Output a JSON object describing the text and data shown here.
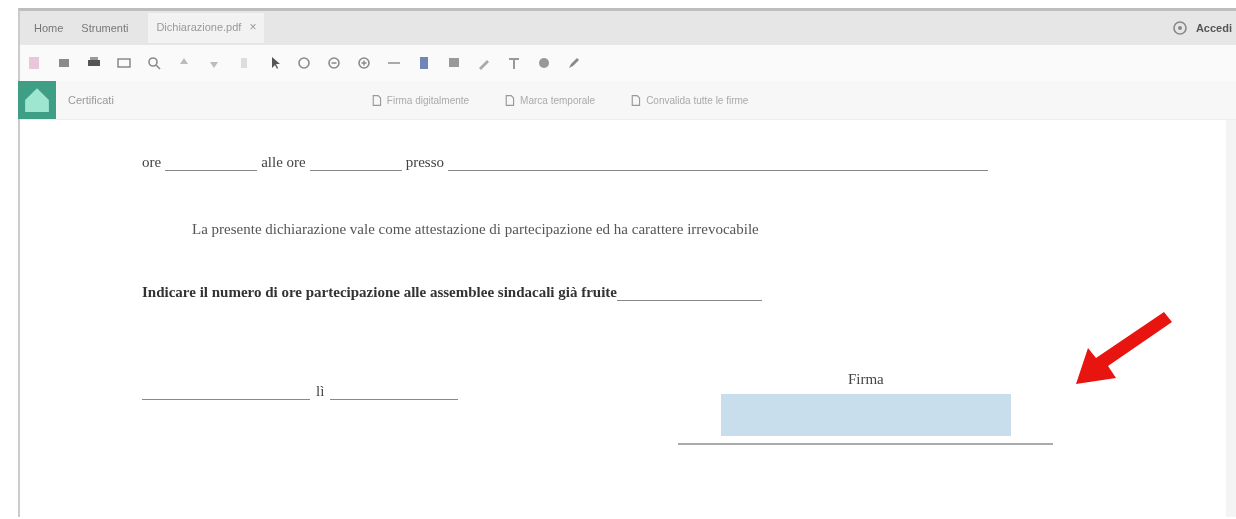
{
  "top_bar": {
    "nav": [
      {
        "label": "Home",
        "selected": false
      },
      {
        "label": "Strumenti",
        "selected": false
      }
    ],
    "document_tab": {
      "label": "Dichiarazione.pdf",
      "close": "×"
    },
    "sign_in": "Accedi"
  },
  "cert_bar": {
    "title": "Certificati",
    "actions": [
      "Firma digitalmente",
      "Marca temporale",
      "Convalida tutte le firme"
    ]
  },
  "document": {
    "time_line": [
      {
        "kind": "text",
        "text": "ore"
      },
      {
        "kind": "blank"
      },
      {
        "kind": "text",
        "text": "alle ore"
      },
      {
        "kind": "blank"
      },
      {
        "kind": "text",
        "text": "presso"
      },
      {
        "kind": "blank",
        "wide": true
      }
    ],
    "statement": "La presente dichiarazione vale come attestazione di partecipazione ed ha carattere irrevocabile",
    "question": "Indicare il numero di ore partecipazione alle assemblee sindacali già fruite",
    "place_word": "lì",
    "signature_label": "Firma"
  }
}
